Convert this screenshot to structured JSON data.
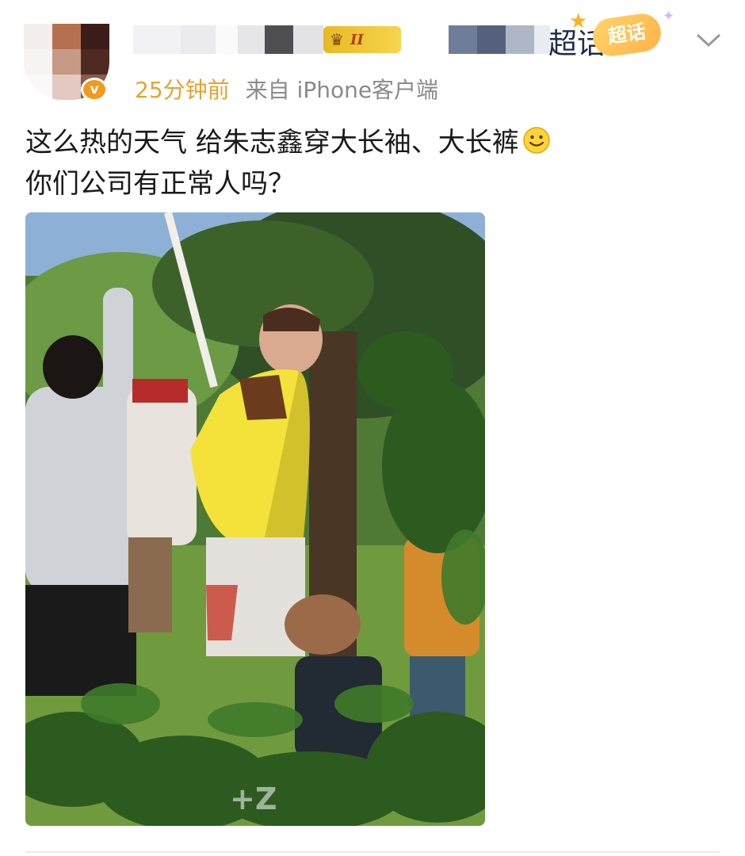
{
  "post": {
    "author": {
      "name_suffix": "超话",
      "rank_badge": "II",
      "supertopic_badge": "超话",
      "verified_mark": "v"
    },
    "meta": {
      "time": "25分钟前",
      "source": "来自 iPhone客户端"
    },
    "content": {
      "line1": "这么热的天气 给朱志鑫穿大长袖、大长裤",
      "line2": "你们公司有正常人吗？"
    },
    "image": {
      "watermark": "+Z"
    }
  },
  "colors": {
    "time": "#e8a22e",
    "source": "#8a8a8a",
    "text": "#1a1a1a",
    "verified": "#f19a1e"
  },
  "icons": [
    "crown-icon",
    "star-icon",
    "sparkle-icon",
    "chevron-down-icon",
    "smile-icon"
  ]
}
